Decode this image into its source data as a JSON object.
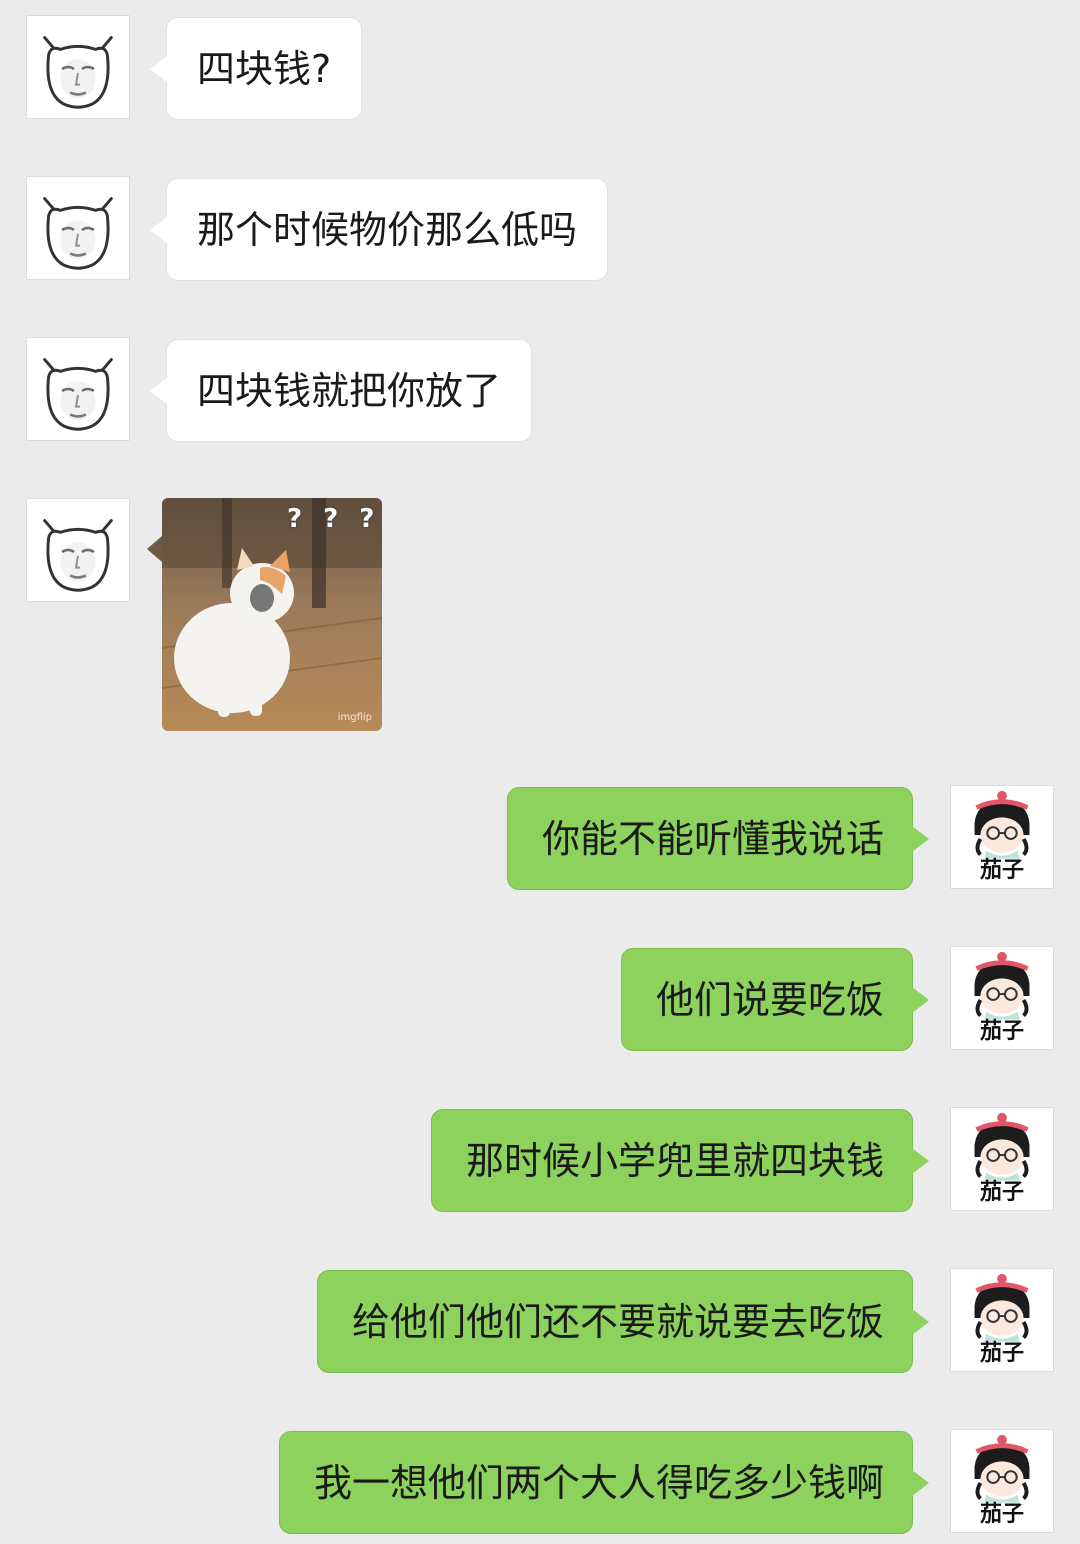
{
  "chat": {
    "messages": [
      {
        "side": "left",
        "type": "text",
        "avatar": "cat-face-avatar-icon",
        "text": "四块钱?"
      },
      {
        "side": "left",
        "type": "text",
        "avatar": "cat-face-avatar-icon",
        "text": "那个时候物价那么低吗"
      },
      {
        "side": "left",
        "type": "text",
        "avatar": "cat-face-avatar-icon",
        "text": "四块钱就把你放了"
      },
      {
        "side": "left",
        "type": "image",
        "avatar": "cat-face-avatar-icon",
        "overlay_text": "? ? ?",
        "watermark": "imgflip"
      },
      {
        "side": "right",
        "type": "text",
        "avatar": "girl-cartoon-avatar-icon",
        "text": "你能不能听懂我说话"
      },
      {
        "side": "right",
        "type": "text",
        "avatar": "girl-cartoon-avatar-icon",
        "text": "他们说要吃饭"
      },
      {
        "side": "right",
        "type": "text",
        "avatar": "girl-cartoon-avatar-icon",
        "text": "那时候小学兜里就四块钱"
      },
      {
        "side": "right",
        "type": "text",
        "avatar": "girl-cartoon-avatar-icon",
        "text": "给他们他们还不要就说要去吃饭"
      },
      {
        "side": "right",
        "type": "text",
        "avatar": "girl-cartoon-avatar-icon",
        "text": "我一想他们两个大人得吃多少钱啊"
      }
    ],
    "right_avatar_label": "茄子",
    "colors": {
      "background": "#ebebeb",
      "left_bubble": "#ffffff",
      "right_bubble": "#8ed25e"
    }
  }
}
